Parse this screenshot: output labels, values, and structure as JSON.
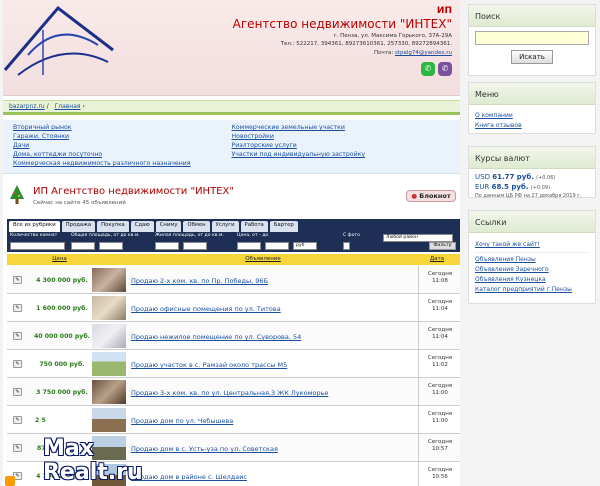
{
  "header": {
    "ip": "ИП",
    "title": "Агентство недвижимости \"ИНТЕХ\"",
    "address": "г. Пенза, ул. Максима Горького, 37А-29А",
    "phones": "Тел.: 522217, 394361, 89273610361, 257330, 89272894361.",
    "email_label": "Почта:",
    "email": "stpalg74@yandex.ru"
  },
  "breadcrumb": [
    "bazarpnz.ru",
    "Главная"
  ],
  "categories": {
    "left": [
      "Вторичный рынок",
      "Гаражи, Стоянки",
      "Дачи",
      "Дома, коттеджи посуточно",
      "Коммерческая недвижимость различного назначения"
    ],
    "right": [
      "Коммерческие земельные участки",
      "Новостройки",
      "Риэлторские услуги",
      "Участки под индивидуальную застройку"
    ]
  },
  "agency": {
    "name": "ИП Агентство недвижимости \"ИНТЕХ\"",
    "count": "Сейчас на сайте 45 объявлений",
    "notepad": "Блокнот"
  },
  "tabs": [
    "Все из рубрики",
    "Продажа",
    "Покупка",
    "Сдаю",
    "Сниму",
    "Обмен",
    "Услуги",
    "Работа",
    "Бартер"
  ],
  "filters": {
    "rooms": "Количество комнат",
    "total_area": "Общая площадь, от до кв.м.",
    "living_area": "Жилая площадь, от до кв.м.",
    "price": "Цена, от - до",
    "photo": "С фото",
    "currency": "руб",
    "any_region": "Любой район",
    "filter_btn": "Фильтр"
  },
  "table_head": {
    "price": "Цена",
    "ad": "Объявление",
    "date": "Дата"
  },
  "listings": [
    {
      "price": "4 300 000 руб.",
      "title": "Продаю 2-х ком. кв. по Пр. Победы, 96Б",
      "day": "Сегодня",
      "time": "11:08"
    },
    {
      "price": "1 600 000 руб.",
      "title": "Продаю офисные помещения по ул. Титова",
      "day": "Сегодня",
      "time": "11:04"
    },
    {
      "price": "40 000 000 руб.",
      "title": "Продаю нежилое помещение по ул. Суворова, 54",
      "day": "Сегодня",
      "time": "11:04"
    },
    {
      "price": "750 000 руб.",
      "title": "Продаю участок в с. Рамзай около трассы М5",
      "day": "Сегодня",
      "time": "11:02"
    },
    {
      "price": "3 750 000 руб.",
      "title": "Продаю 3-х ком. кв. по ул. Центральная,3 ЖК Лукоморье",
      "day": "Сегодня",
      "time": "11:00"
    },
    {
      "price": "2 5",
      "title": "Продаю дом по ул. Чебышева",
      "day": "Сегодня",
      "time": "11:00"
    },
    {
      "price": "87",
      "title": "Продаю дом в с. Усть-уза по ул. Советская",
      "day": "Сегодня",
      "time": "10:57"
    },
    {
      "price": "4 100 000 руб.",
      "title": "Продаю дом в районе с. Шелдаис",
      "day": "Сегодня",
      "time": "10:56"
    }
  ],
  "watermark": {
    "line1": "Max",
    "line2": "Realt.ru"
  },
  "sidebar": {
    "search": {
      "title": "Поиск",
      "button": "Искать"
    },
    "menu": {
      "title": "Меню",
      "items": [
        "О компании",
        "Книга отзывов"
      ]
    },
    "currency": {
      "title": "Курсы валют",
      "usd": {
        "code": "USD",
        "value": "61.77 руб.",
        "delta": "(+0.06)"
      },
      "eur": {
        "code": "EUR",
        "value": "68.5 руб.",
        "delta": "(+0.09)"
      },
      "note": "По данным ЦБ РФ на 27 декабря 2019 г."
    },
    "links": {
      "title": "Ссылки",
      "items": [
        "Хочу такой же сайт!",
        "Объявления Пензы",
        "Объявления Заречного",
        "Объявления Кузнецка",
        "Каталог предприятий г.Пензы"
      ]
    }
  }
}
